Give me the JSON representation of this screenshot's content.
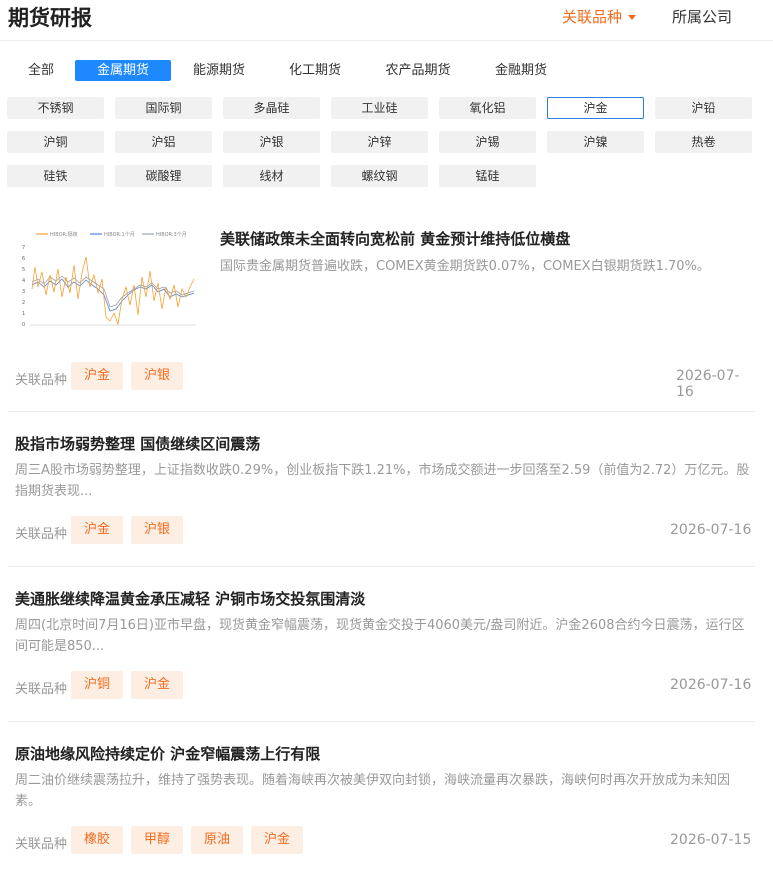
{
  "header": {
    "title": "期货研报",
    "related_label": "关联品种",
    "company_label": "所属公司"
  },
  "category_tabs": [
    "全部",
    "金属期货",
    "能源期货",
    "化工期货",
    "农产品期货",
    "金融期货"
  ],
  "active_category": 1,
  "varieties": [
    "不锈钢",
    "国际铜",
    "多晶硅",
    "工业硅",
    "氧化铝",
    "沪金",
    "沪铅",
    "沪铜",
    "沪铝",
    "沪银",
    "沪锌",
    "沪锡",
    "沪镍",
    "热卷",
    "硅铁",
    "碳酸锂",
    "线材",
    "螺纹钢",
    "锰硅"
  ],
  "active_variety": 5,
  "related_prefix": "关联品种",
  "thumbnail": {
    "legend": [
      "HIBOR:隔夜",
      "HIBOR:1个月",
      "HIBOR:3个月"
    ],
    "y_ticks": [
      "7",
      "6",
      "5",
      "4",
      "3",
      "2",
      "1",
      "0"
    ],
    "colors": {
      "orange": "#f5a033",
      "blue": "#4f86d6",
      "gray": "#9aa4b2"
    }
  },
  "articles": [
    {
      "title": "美联储政策未全面转向宽松前 黄金预计维持低位横盘",
      "summary": "国际贵金属期货普遍收跌，COMEX黄金期货跌0.07%，COMEX白银期货跌1.70%。",
      "tags": [
        "沪金",
        "沪银"
      ],
      "date": "2026-07-16"
    },
    {
      "title": "股指市场弱势整理 国债继续区间震荡",
      "summary": "周三A股市场弱势整理，上证指数收跌0.29%，创业板指下跌1.21%，市场成交额进一步回落至2.59（前值为2.72）万亿元。股指期货表现...",
      "tags": [
        "沪金",
        "沪银"
      ],
      "date": "2026-07-16"
    },
    {
      "title": "美通胀继续降温黄金承压减轻 沪铜市场交投氛围清淡",
      "summary": "周四(北京时间7月16日)亚市早盘，现货黄金窄幅震荡，现货黄金交投于4060美元/盎司附近。沪金2608合约今日震荡，运行区间可能是850...",
      "tags": [
        "沪铜",
        "沪金"
      ],
      "date": "2026-07-16"
    },
    {
      "title": "原油地缘风险持续定价 沪金窄幅震荡上行有限",
      "summary": "周二油价继续震荡拉升，维持了强势表现。随着海峡再次被美伊双向封锁，海峡流量再次暴跌，海峡何时再次开放成为未知因素。",
      "tags": [
        "橡胶",
        "甲醇",
        "原油",
        "沪金"
      ],
      "date": "2026-07-15"
    }
  ]
}
